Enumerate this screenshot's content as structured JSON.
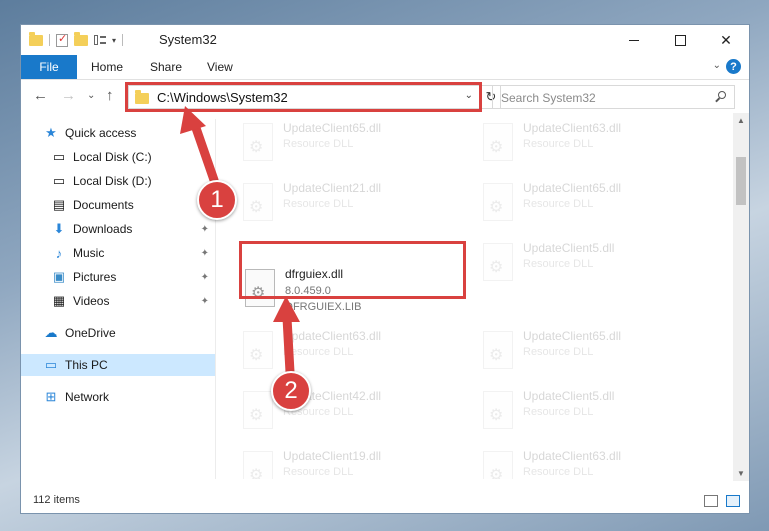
{
  "window": {
    "title": "System32",
    "close_glyph": "✕"
  },
  "ribbon": {
    "file_label": "File",
    "tabs": [
      "Home",
      "Share",
      "View"
    ],
    "help": "?"
  },
  "navbar": {
    "back": "←",
    "forward": "→",
    "recent": "⌄",
    "up": "↑",
    "address": "C:\\Windows\\System32",
    "refresh": "↻",
    "search_placeholder": "Search System32"
  },
  "sidebar": {
    "items": [
      {
        "label": "Quick access",
        "icon": "star-icon",
        "glyph": "★"
      },
      {
        "label": "Local Disk (C:)",
        "icon": "drive-icon",
        "glyph": "▭"
      },
      {
        "label": "Local Disk (D:)",
        "icon": "drive-icon",
        "glyph": "▭"
      },
      {
        "label": "Documents",
        "icon": "documents-icon",
        "glyph": "▤"
      },
      {
        "label": "Downloads",
        "icon": "downloads-icon",
        "glyph": "⬇"
      },
      {
        "label": "Music",
        "icon": "music-icon",
        "glyph": "♪"
      },
      {
        "label": "Pictures",
        "icon": "pictures-icon",
        "glyph": "▣"
      },
      {
        "label": "Videos",
        "icon": "videos-icon",
        "glyph": "▦"
      },
      {
        "label": "OneDrive",
        "icon": "cloud-icon",
        "glyph": "☁"
      },
      {
        "label": "This PC",
        "icon": "computer-icon",
        "glyph": "▭"
      },
      {
        "label": "Network",
        "icon": "network-icon",
        "glyph": "⊞"
      }
    ],
    "pin_glyph": "📌"
  },
  "files": [
    {
      "name": "UpdateClient65.dll",
      "type": "Resource DLL"
    },
    {
      "name": "UpdateClient63.dll",
      "type": "Resource DLL"
    },
    {
      "name": "UpdateClient21.dll",
      "type": "Resource DLL"
    },
    {
      "name": "UpdateClient65.dll",
      "type": "Resource DLL"
    },
    {
      "name": "dfrguiex.dll",
      "version": "8.0.459.0",
      "type": "DFRGUIEX.LIB"
    },
    {
      "name": "UpdateClient5.dll",
      "type": "Resource DLL"
    },
    {
      "name": "UpdateClient63.dll",
      "type": "Resource DLL"
    },
    {
      "name": "UpdateClient65.dll",
      "type": "Resource DLL"
    },
    {
      "name": "UpdateClient42.dll",
      "type": "Resource DLL"
    },
    {
      "name": "UpdateClient5.dll",
      "type": "Resource DLL"
    },
    {
      "name": "UpdateClient19.dll",
      "type": "Resource DLL"
    },
    {
      "name": "UpdateClient63.dll",
      "type": "Resource DLL"
    }
  ],
  "status": {
    "items_count": "112 items"
  },
  "callouts": [
    "1",
    "2"
  ],
  "colors": {
    "accent": "#1979ca",
    "highlight": "#d9413f",
    "selected": "#cce8ff"
  }
}
